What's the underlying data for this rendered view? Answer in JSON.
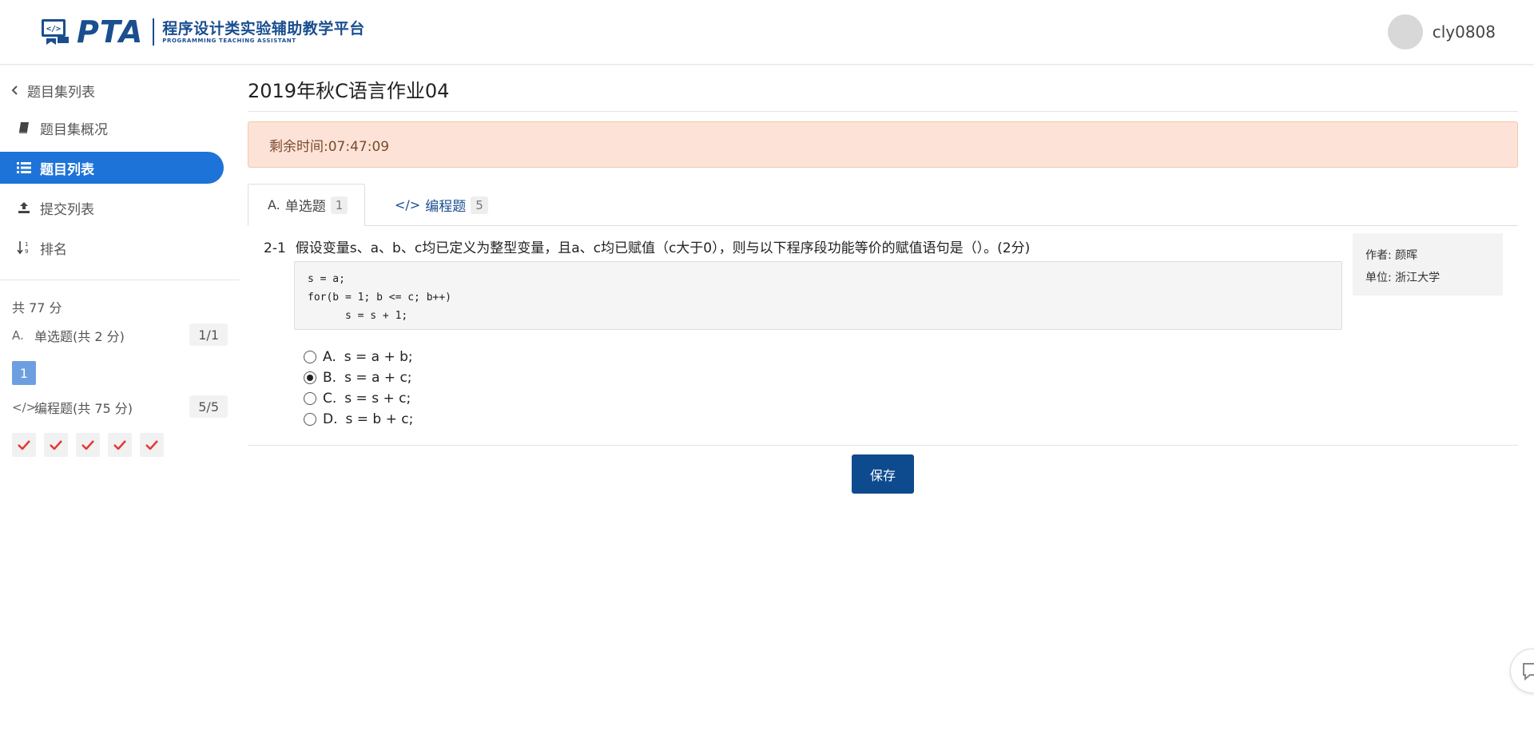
{
  "header": {
    "logo_text": "PTA",
    "logo_cn": "程序设计类实验辅助教学平台",
    "logo_en": "PROGRAMMING TEACHING ASSISTANT",
    "username": "cly0808"
  },
  "sidebar": {
    "back_label": "题目集列表",
    "items": [
      {
        "label": "题目集概况",
        "icon": "book-icon"
      },
      {
        "label": "题目列表",
        "icon": "list-icon",
        "active": true
      },
      {
        "label": "提交列表",
        "icon": "upload-icon"
      },
      {
        "label": "排名",
        "icon": "sort-icon"
      }
    ],
    "total": "共 77 分",
    "categories": [
      {
        "label": "单选题(共 2 分)",
        "count": "1/1",
        "icon": "A."
      },
      {
        "label": "编程题(共 75 分)",
        "count": "5/5",
        "icon": "</>"
      }
    ],
    "single_choice_numbers": [
      "1"
    ]
  },
  "main": {
    "title": "2019年秋C语言作业04",
    "timer": "剩余时间:07:47:09",
    "tabs": [
      {
        "icon": "A.",
        "label": "单选题",
        "badge": "1"
      },
      {
        "icon": "</>",
        "label": "编程题",
        "badge": "5"
      }
    ],
    "question": {
      "number": "2-1",
      "text": "假设变量s、a、b、c均已定义为整型变量，且a、c均已赋值（c大于0），则与以下程序段功能等价的赋值语句是（）。(2分)",
      "code": "s = a;\nfor(b = 1; b <= c; b++)\n      s = s + 1;",
      "options": [
        {
          "letter": "A.",
          "text": "s = a + b;",
          "checked": false
        },
        {
          "letter": "B.",
          "text": "s = a + c;",
          "checked": true
        },
        {
          "letter": "C.",
          "text": "s = s + c;",
          "checked": false
        },
        {
          "letter": "D.",
          "text": "s = b + c;",
          "checked": false
        }
      ]
    },
    "author": {
      "author_line": "作者: 颜晖",
      "unit_line": "单位: 浙江大学"
    },
    "save_label": "保存"
  },
  "colors": {
    "brand": "#1a4e8f",
    "active_nav": "#1e73d8",
    "save_button": "#0e4b8e",
    "timer_bg": "#fde3d7",
    "check_red": "#e53935"
  }
}
